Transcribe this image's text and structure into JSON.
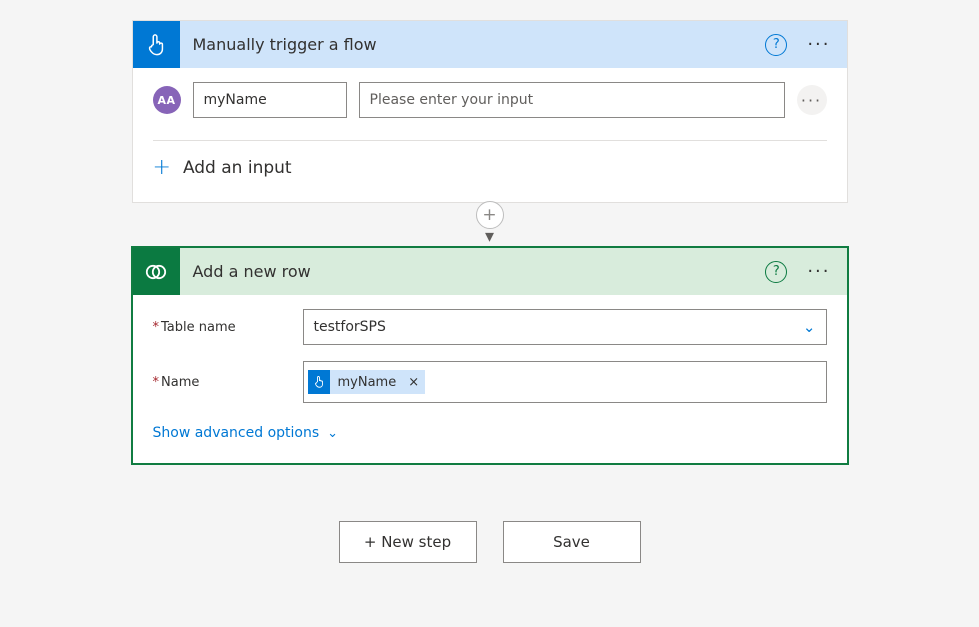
{
  "trigger": {
    "title": "Manually trigger a flow",
    "input_name": "myName",
    "input_prompt": "Please enter your input",
    "add_input_label": "Add an input"
  },
  "action": {
    "title": "Add a new row",
    "fields": {
      "table_label": "Table name",
      "table_value": "testforSPS",
      "name_label": "Name",
      "name_token": "myName"
    },
    "advanced_label": "Show advanced options"
  },
  "footer": {
    "new_step": "+ New step",
    "save": "Save"
  }
}
